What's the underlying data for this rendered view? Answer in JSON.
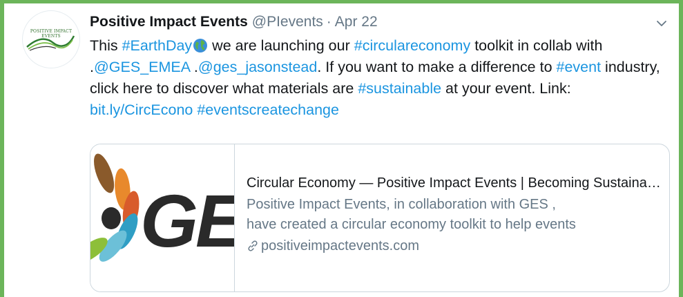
{
  "tweet": {
    "avatar_text": "POSITIVE IMPACT EVENTS",
    "author_name": "Positive Impact Events",
    "handle": "@PIevents",
    "separator": "·",
    "date": "Apr 22",
    "body": {
      "t1": "This ",
      "h_earthday": "#EarthDay",
      "t2": " we are launching our ",
      "h_circular": "#circulareconomy",
      "t3": " toolkit in collab with .",
      "m_ges": "@GES_EMEA",
      "t4": " .",
      "m_jason": "@ges_jasonstead",
      "t5": ". If you want to make a difference to ",
      "h_event": "#event",
      "t6": " industry, click here to discover what materials are ",
      "h_sustainable": "#sustainable",
      "t7": " at your event. Link: ",
      "link": "bit.ly/CircEcono",
      "t8": " ",
      "h_eventscreatechange": "#eventscreatechange"
    },
    "card": {
      "image_text": "GE",
      "title": "Circular Economy — Positive Impact Events | Becoming Sustainable",
      "desc_line1": "Positive Impact Events, in collaboration with GES ,",
      "desc_line2": "have created a circular economy toolkit to help events",
      "url": "positiveimpactevents.com"
    }
  },
  "colors": {
    "frame": "#6cb55a",
    "link": "#1b95e0",
    "muted": "#657786",
    "text": "#14171a"
  },
  "icons": [
    "chevron-down-icon",
    "earth-globe-emoji",
    "link-icon"
  ]
}
